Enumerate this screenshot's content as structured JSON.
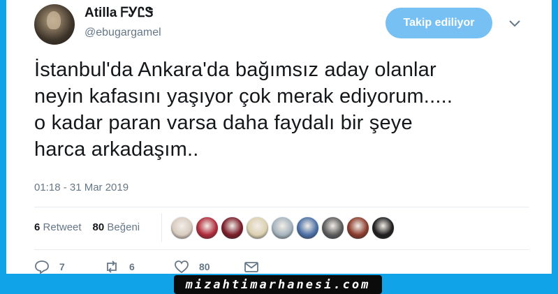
{
  "user": {
    "display_name": "Atilla ᖴᎩᏝᏕ",
    "handle": "@ebugargamel",
    "avatar_icon": "profile-photo"
  },
  "follow_button": {
    "label": "Takip ediliyor",
    "color": "#77c0f4"
  },
  "menu": {
    "icon": "chevron-down-icon"
  },
  "tweet": {
    "text": "İstanbul'da Ankara'da bağımsız aday olanlar\nneyin kafasını yaşıyor çok merak ediyorum.....\no kadar paran varsa daha faydalı bir şeye\nharca arkadaşım..",
    "timestamp": "01:18 - 31 Mar 2019"
  },
  "stats": {
    "retweets_count": "6",
    "retweets_label": "Retweet",
    "likes_count": "80",
    "likes_label": "Beğeni"
  },
  "likers": [
    {
      "color": "#d9cbbf"
    },
    {
      "color": "#b02a3a"
    },
    {
      "color": "#7a1c28"
    },
    {
      "color": "#dcd0b0"
    },
    {
      "color": "#a5b3bd"
    },
    {
      "color": "#4a6fa5"
    },
    {
      "color": "#5b5b5b"
    },
    {
      "color": "#8a3a2a"
    },
    {
      "color": "#1e1e1e"
    }
  ],
  "actions": {
    "reply_count": "7",
    "retweet_count": "6",
    "like_count": "80"
  },
  "watermark": "mizahtimarhanesi.com",
  "colors": {
    "frame": "#10a3e7",
    "text": "#14171a",
    "muted": "#657786"
  }
}
